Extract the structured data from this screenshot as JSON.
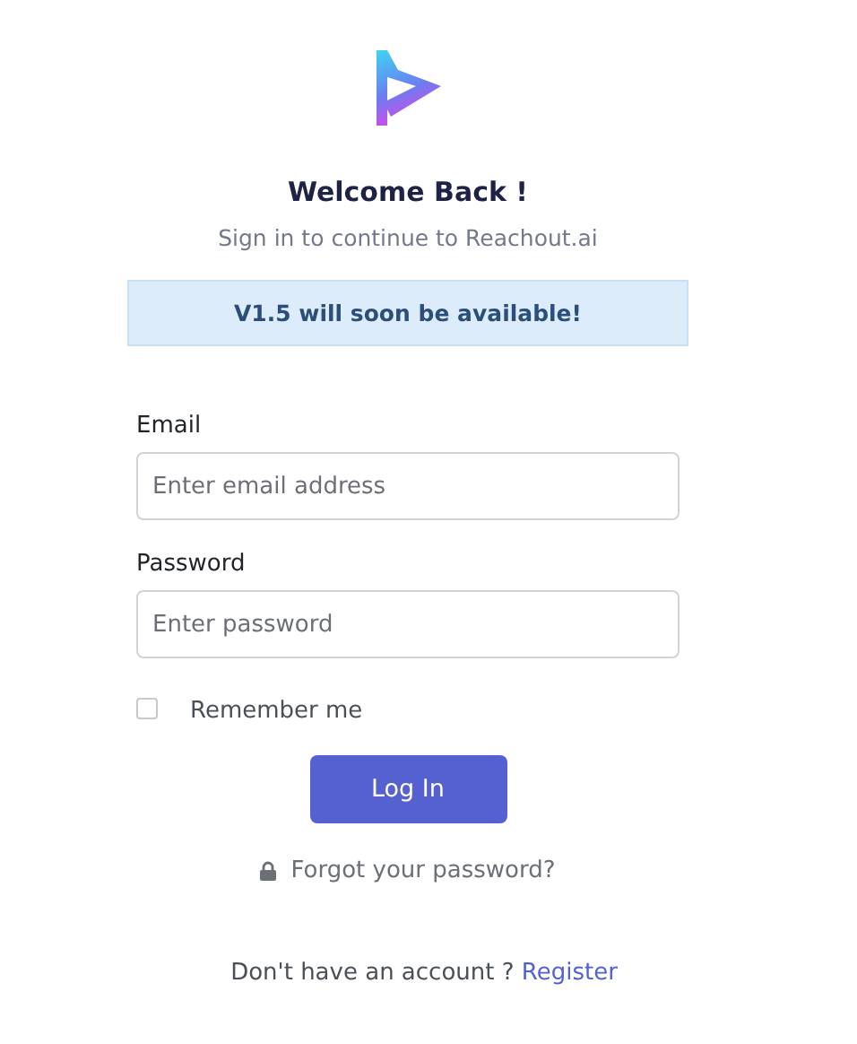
{
  "title": "Welcome Back !",
  "subtitle": "Sign in to continue to Reachout.ai",
  "notice": "V1.5 will soon be available!",
  "fields": [
    {
      "label": "Email",
      "placeholder": "Enter email address"
    },
    {
      "label": "Password",
      "placeholder": "Enter password"
    }
  ],
  "remember": {
    "label": "Remember me",
    "checked": false
  },
  "login_button": "Log In",
  "forgot_link": "Forgot your password?",
  "footer": {
    "text": "Don't have an account ?",
    "link": "Register"
  }
}
